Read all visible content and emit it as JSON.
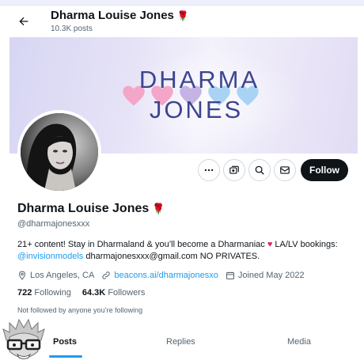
{
  "header": {
    "back_icon": "back-arrow-icon",
    "name": "Dharma Louise Jones",
    "posts_count": "10.3K posts"
  },
  "banner": {
    "line1": "DHARMA",
    "line2": "JONES",
    "heart_colors": [
      "#f4a6c8",
      "#f4a6c8",
      "#c5b3e6",
      "#a9d3f5",
      "#a9d3f5"
    ]
  },
  "actions": {
    "more_icon": "more-icon",
    "subscribe_icon": "subscribe-icon",
    "search_icon": "search-icon",
    "message_icon": "message-icon",
    "follow_label": "Follow"
  },
  "profile": {
    "display_name": "Dharma Louise Jones",
    "handle": "@dharmajonesxxx",
    "bio_part1": "21+ content! Stay in Dharmaland & you’ll become a Dharmaniac ",
    "bio_heart": "♥",
    "bio_part2": " LA/LV bookings: ",
    "bio_mention": "@invisionmodels",
    "bio_part3": " dharmajonesxxx@gmail.com NO PRIVATES.",
    "location": "Los Angeles, CA",
    "website": "beacons.ai/dharmajonesxo",
    "joined": "Joined May 2022",
    "following_count": "722",
    "following_label": "Following",
    "followers_count": "64.3K",
    "followers_label": "Followers",
    "followed_by": "Not followed by anyone you’re following"
  },
  "tabs": [
    {
      "label": "Posts",
      "active": true
    },
    {
      "label": "Replies",
      "active": false
    },
    {
      "label": "Media",
      "active": false
    }
  ],
  "colors": {
    "accent": "#1d9bf0",
    "text": "#0f1419",
    "muted": "#536471",
    "rose": "#c8102e"
  }
}
